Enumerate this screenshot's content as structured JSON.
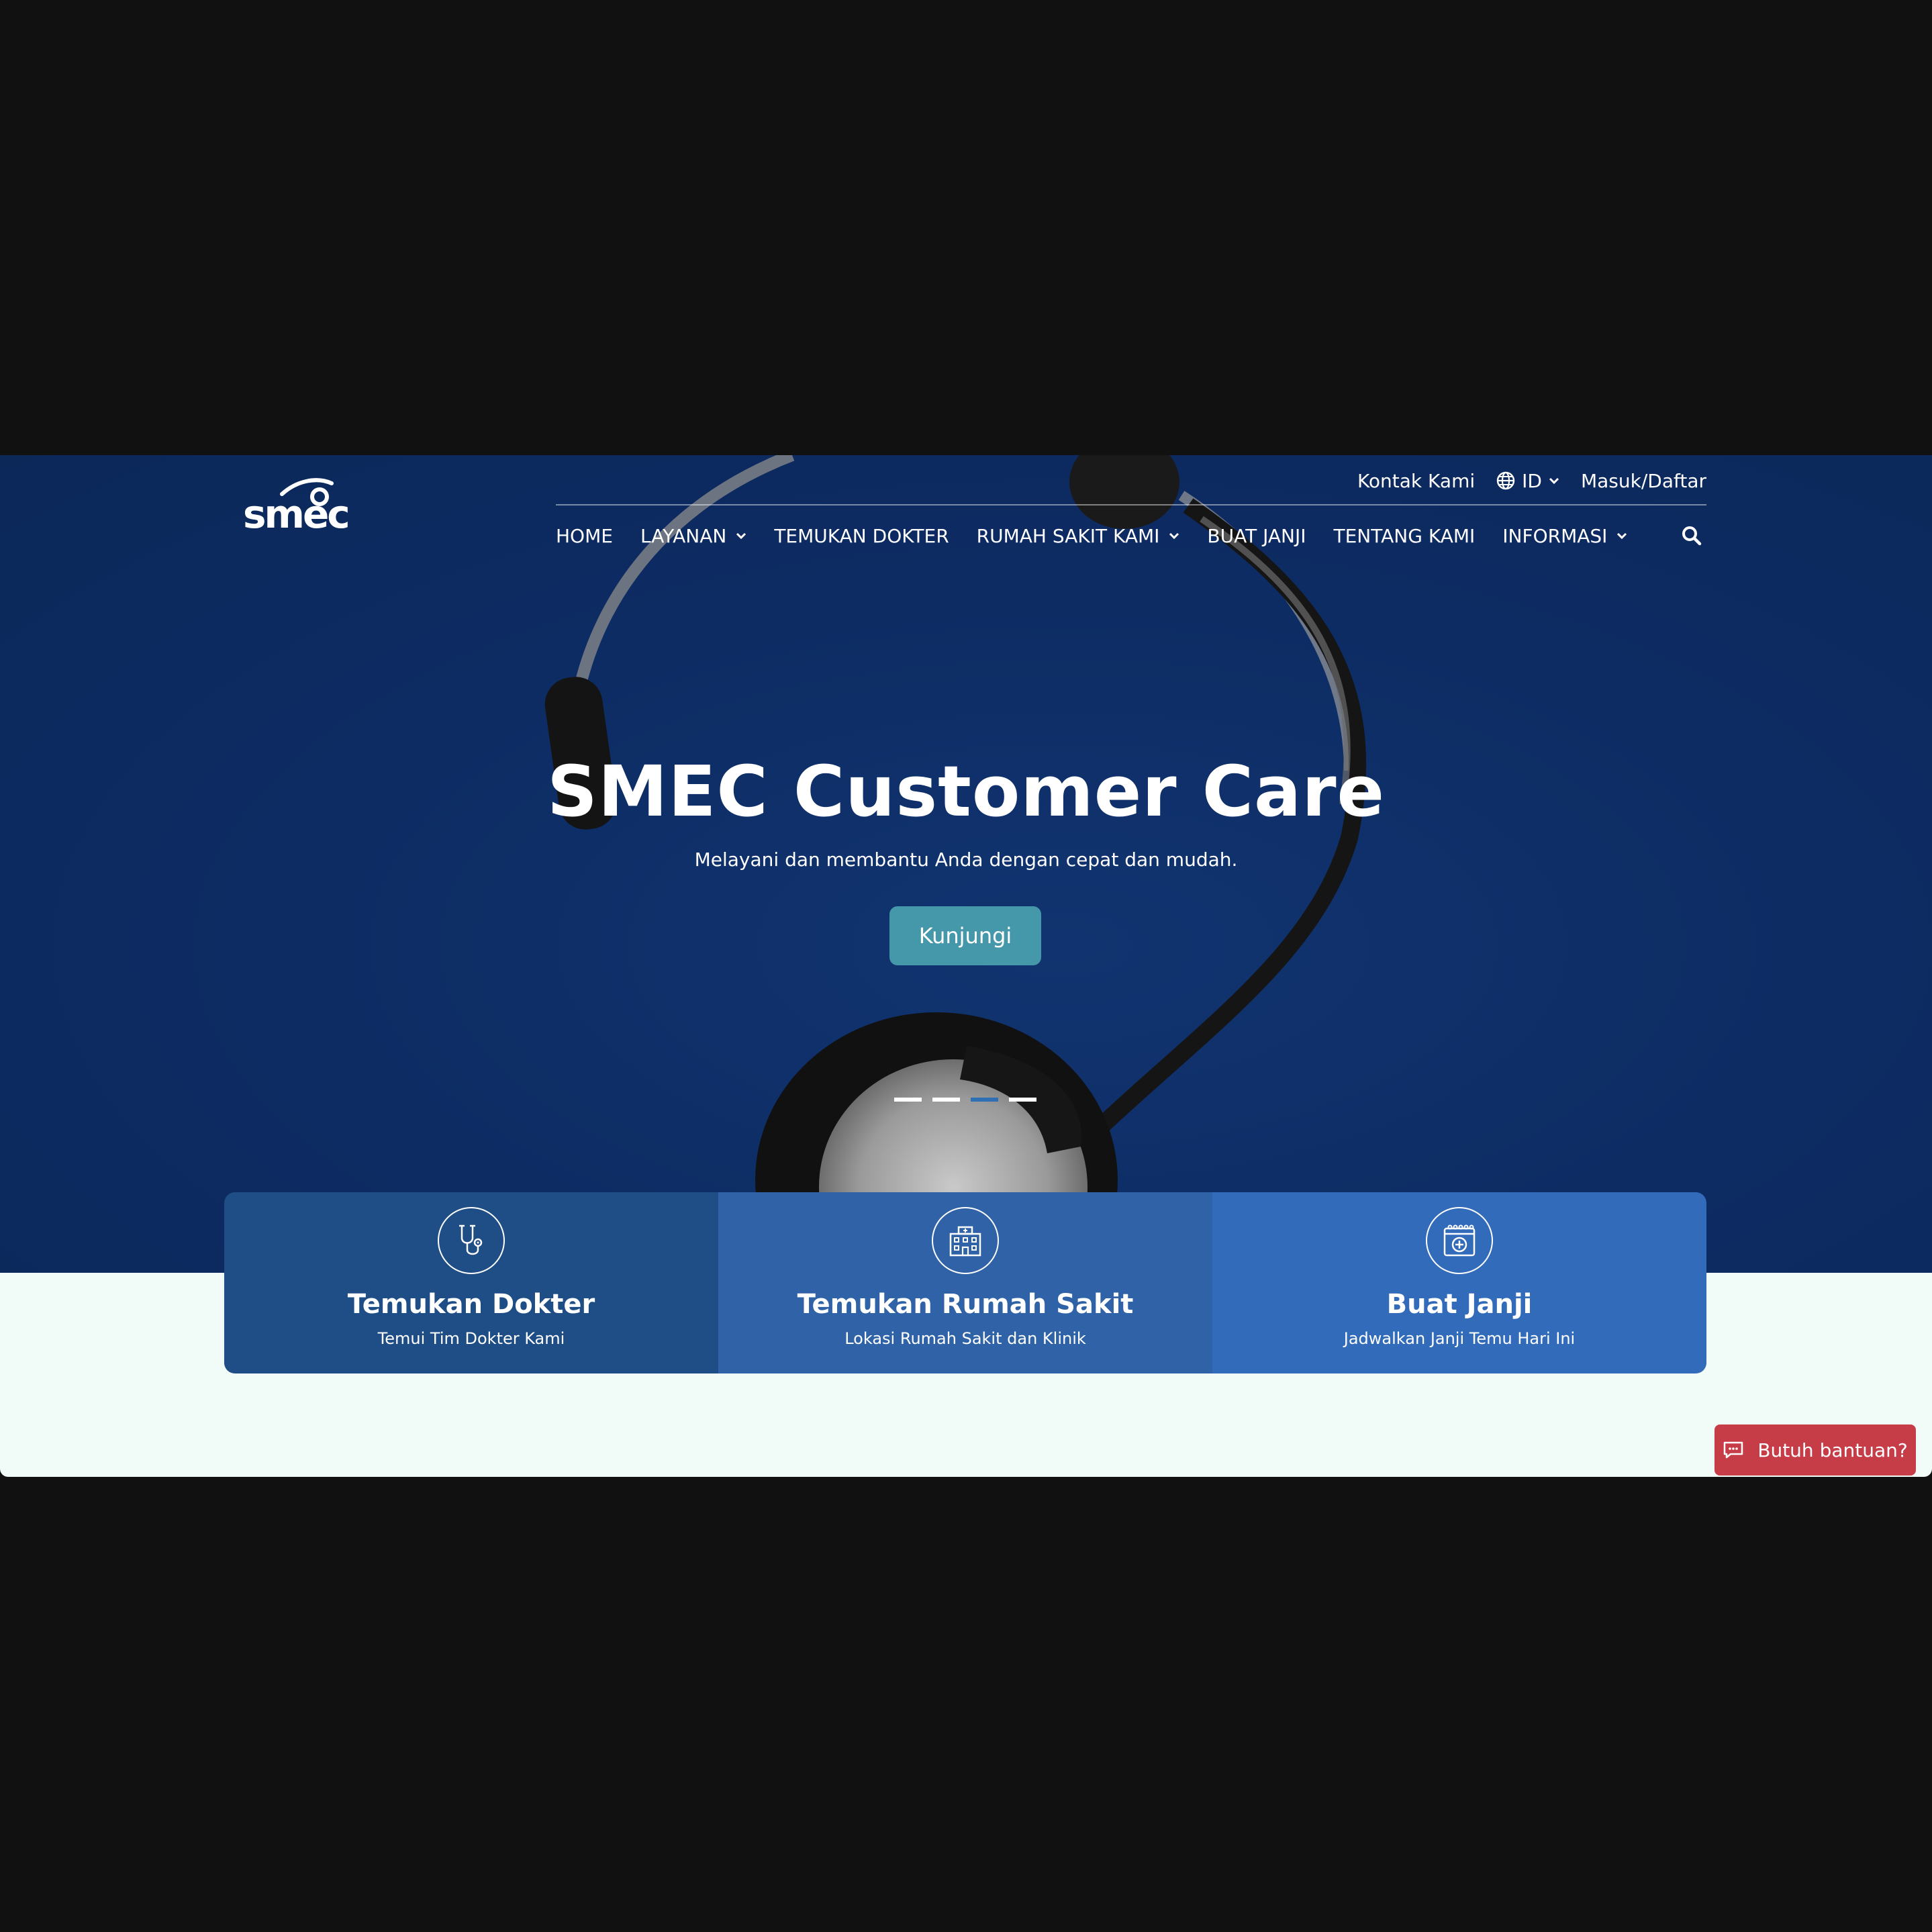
{
  "brand": {
    "logo_text": "smec"
  },
  "topbar": {
    "contact": "Kontak Kami",
    "language": "ID",
    "login": "Masuk/Daftar"
  },
  "nav": {
    "home": "HOME",
    "layanan": "LAYANAN",
    "temukan_dokter": "TEMUKAN DOKTER",
    "rumah_sakit": "RUMAH SAKIT KAMI",
    "buat_janji": "BUAT JANJI",
    "tentang": "TENTANG KAMI",
    "informasi": "INFORMASI"
  },
  "hero": {
    "title": "SMEC Customer Care",
    "subtitle": "Melayani dan membantu Anda dengan cepat dan mudah.",
    "cta": "Kunjungi",
    "slide_count": 4,
    "active_slide": 3
  },
  "cards": [
    {
      "title": "Temukan Dokter",
      "subtitle": "Temui Tim Dokter Kami",
      "icon": "stethoscope-icon",
      "color": "#1f4d85"
    },
    {
      "title": "Temukan Rumah Sakit",
      "subtitle": "Lokasi Rumah Sakit dan Klinik",
      "icon": "hospital-icon",
      "color": "#2f62a6"
    },
    {
      "title": "Buat Janji",
      "subtitle": "Jadwalkan Janji Temu Hari Ini",
      "icon": "calendar-icon",
      "color": "#326bba"
    }
  ],
  "help": {
    "label": "Butuh bantuan?",
    "color": "#c63c47"
  },
  "colors": {
    "hero_bg": "#0d2c64",
    "cta": "#4597aa",
    "page_bg": "#f1fbf7"
  }
}
